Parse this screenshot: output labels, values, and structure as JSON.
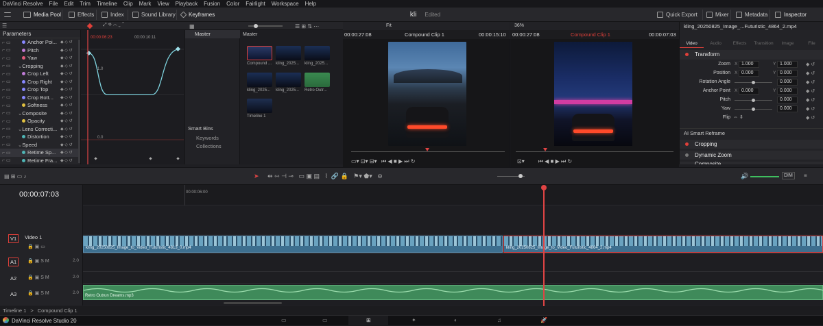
{
  "menu": [
    "DaVinci Resolve",
    "File",
    "Edit",
    "Trim",
    "Timeline",
    "Clip",
    "Mark",
    "View",
    "Playback",
    "Fusion",
    "Color",
    "Fairlight",
    "Workspace",
    "Help"
  ],
  "toolbar": {
    "media_pool": "Media Pool",
    "effects": "Effects",
    "index": "Index",
    "sound_library": "Sound Library",
    "keyframes": "Keyframes",
    "project_name": "kli",
    "project_state": "Edited",
    "quick_export": "Quick Export",
    "mixer": "Mixer",
    "metadata": "Metadata",
    "inspector": "Inspector"
  },
  "keyframes": {
    "header": "Parameters",
    "params": [
      {
        "label": "Anchor Poi...",
        "indent": 2,
        "color": "#8888ff"
      },
      {
        "label": "Pitch",
        "indent": 2,
        "color": "#c07bd6"
      },
      {
        "label": "Yaw",
        "indent": 2,
        "color": "#e05a7a"
      },
      {
        "label": "Cropping",
        "indent": 1,
        "color": ""
      },
      {
        "label": "Crop Left",
        "indent": 2,
        "color": "#c07bd6"
      },
      {
        "label": "Crop Right",
        "indent": 2,
        "color": "#8888ff"
      },
      {
        "label": "Crop Top",
        "indent": 2,
        "color": "#8888ff"
      },
      {
        "label": "Crop Bott...",
        "indent": 2,
        "color": "#8888ff"
      },
      {
        "label": "Softness",
        "indent": 2,
        "color": "#e0c040"
      },
      {
        "label": "Composite",
        "indent": 1,
        "color": ""
      },
      {
        "label": "Opacity",
        "indent": 2,
        "color": "#e0c040"
      },
      {
        "label": "Lens Correcti...",
        "indent": 1,
        "color": ""
      },
      {
        "label": "Distortion",
        "indent": 2,
        "color": "#4fb5b5"
      },
      {
        "label": "Speed",
        "indent": 1,
        "color": ""
      },
      {
        "label": "Retime Sp...",
        "indent": 2,
        "color": "#4fb5b5"
      },
      {
        "label": "Retime Fra...",
        "indent": 2,
        "color": "#4fb5b5"
      }
    ],
    "ruler_left": "00:00:06:23",
    "ruler_right": "00:00:10:11",
    "value_high": "1.0",
    "value_low": "0.0"
  },
  "media_pool": {
    "bin_master": "Master",
    "header_master": "Master",
    "smart_bins": "Smart Bins",
    "keywords": "Keywords",
    "collections": "Collections",
    "clips": [
      {
        "label": "Compound ...",
        "kind": "compound"
      },
      {
        "label": "kling_2025...",
        "kind": "video"
      },
      {
        "label": "kling_2025...",
        "kind": "video"
      },
      {
        "label": "kling_2025...",
        "kind": "video"
      },
      {
        "label": "kling_2025...",
        "kind": "video"
      },
      {
        "label": "Retro Outr...",
        "kind": "audio"
      },
      {
        "label": "Timeline 1",
        "kind": "timeline"
      }
    ]
  },
  "source_viewer": {
    "timecode_left": "00:00:27:08",
    "fit": "Fit",
    "clip_name": "Compound Clip 1",
    "timecode_right": "00:00:15:10"
  },
  "program_viewer": {
    "zoom": "36%",
    "timecode_left": "00:00:27:08",
    "clip_name": "Compound Clip 1",
    "timecode_right": "00:00:07:03"
  },
  "inspector": {
    "clip_title": "kling_20250825_Image_...Futuristic_4864_2.mp4",
    "tabs": [
      "Video",
      "Audio",
      "Effects",
      "Transition",
      "Image",
      "File"
    ],
    "transform": "Transform",
    "rows": [
      {
        "label": "Zoom",
        "x": "1.000",
        "y": "1.000"
      },
      {
        "label": "Position",
        "x": "0.000",
        "y": "0.000"
      },
      {
        "label": "Rotation Angle",
        "v": "0.000"
      },
      {
        "label": "Anchor Point",
        "x": "0.000",
        "y": "0.000"
      },
      {
        "label": "Pitch",
        "v": "0.000"
      },
      {
        "label": "Yaw",
        "v": "0.000"
      },
      {
        "label": "Flip",
        "v": ""
      }
    ],
    "ai_reframe": "AI Smart Reframe",
    "cropping": "Cropping",
    "dynamic_zoom": "Dynamic Zoom",
    "composite": "Composite"
  },
  "timeline": {
    "timecode": "00:00:07:03",
    "ruler_mark": "00:00:06:00",
    "dim": "DIM",
    "tracks": [
      {
        "id": "V1",
        "name": "Video 1"
      },
      {
        "id": "A1",
        "name": "",
        "level": "2.0"
      },
      {
        "id": "A2",
        "name": "",
        "level": "2.0"
      },
      {
        "id": "A3",
        "name": "",
        "level": "2.0"
      }
    ],
    "clip_v1_a": "kling_20250825_Image_to_Video_Futuristic_4813_0.mp4",
    "clip_v1_b": "kling_20250825_Image_to_Video_Futuristic_4864_2.mp4",
    "clip_a3": "Retro Outrun Dreams.mp3"
  },
  "status": {
    "timeline": "Timeline 1",
    "sep": ">",
    "compound": "Compound Clip 1"
  },
  "footer": {
    "app": "DaVinci Resolve Studio 20"
  },
  "colors": {
    "accent_red": "#e0403a",
    "playhead": "#e04444",
    "video_clip": "#3d6f8f",
    "audio_clip": "#3f8a5a"
  }
}
